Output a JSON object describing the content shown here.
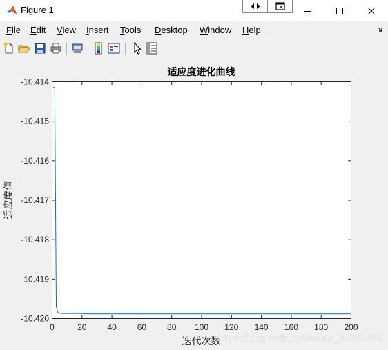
{
  "window": {
    "title": "Figure 1",
    "controls": [
      "minimize",
      "maximize",
      "close"
    ]
  },
  "menu": {
    "items": [
      {
        "label": "File",
        "accel": "F",
        "rest": "ile"
      },
      {
        "label": "Edit",
        "accel": "E",
        "rest": "dit"
      },
      {
        "label": "View",
        "accel": "V",
        "rest": "iew"
      },
      {
        "label": "Insert",
        "accel": "I",
        "rest": "nsert"
      },
      {
        "label": "Tools",
        "accel": "T",
        "rest": "ools"
      },
      {
        "label": "Desktop",
        "accel": "D",
        "rest": "esktop"
      },
      {
        "label": "Window",
        "accel": "W",
        "rest": "indow"
      },
      {
        "label": "Help",
        "accel": "H",
        "rest": "elp"
      }
    ]
  },
  "toolbar": {
    "tools": [
      "new-figure",
      "open-file",
      "save",
      "print",
      "print-preview",
      "insert-colorbar",
      "insert-legend",
      "edit-plot",
      "property-inspector"
    ]
  },
  "chart_data": {
    "type": "line",
    "title": "适应度进化曲线",
    "xlabel": "迭代次数",
    "ylabel": "适应度值",
    "xlim": [
      0,
      200
    ],
    "ylim": [
      -10.42,
      -10.414
    ],
    "xticks": [
      0,
      20,
      40,
      60,
      80,
      100,
      120,
      140,
      160,
      180,
      200
    ],
    "yticks": [
      -10.414,
      -10.415,
      -10.416,
      -10.417,
      -10.418,
      -10.419,
      -10.42
    ],
    "grid": false,
    "legend": "none",
    "line_color": "#0072bd",
    "series": [
      {
        "x": [
          1,
          2,
          3,
          4,
          5,
          6,
          8,
          10,
          15,
          20,
          22,
          25,
          30,
          40,
          60,
          80,
          100,
          120,
          140,
          160,
          180,
          200
        ],
        "y": [
          -10.41415,
          -10.41415,
          -10.4197,
          -10.41985,
          -10.41987,
          -10.41988,
          -10.41988,
          -10.41988,
          -10.41988,
          -10.41988,
          -10.41989,
          -10.41989,
          -10.41989,
          -10.41989,
          -10.41989,
          -10.41989,
          -10.41989,
          -10.41989,
          -10.41989,
          -10.41989,
          -10.41989,
          -10.41989
        ]
      }
    ]
  },
  "watermark": "https://blog.csdn.net/weixin_44331401"
}
